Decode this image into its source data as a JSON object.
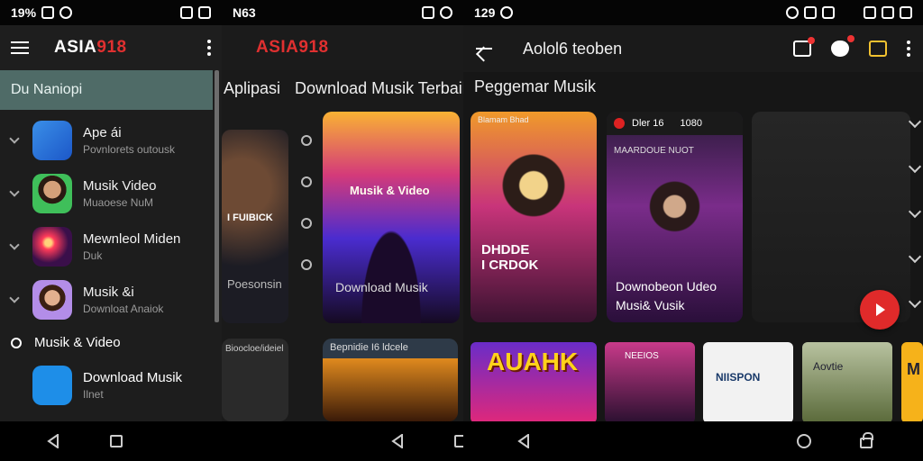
{
  "status": {
    "s1_left": "19%",
    "s2_left": "N63",
    "s3_left": "129"
  },
  "drawer": {
    "logo_white": "ASIA",
    "logo_red": "918",
    "search_text": "Du Naniopi",
    "items": [
      {
        "title": "Ape ái",
        "subtitle": "Povnlorets outousk",
        "icon": "blue-feather-icon"
      },
      {
        "title": "Musik Video",
        "subtitle": "Muaoese NuM",
        "icon": "singer-face-icon"
      },
      {
        "title": "Mewnleol Miden",
        "subtitle": "Duk",
        "icon": "concert-icon"
      },
      {
        "title": "Musik &i",
        "subtitle": "Downloat Anaiok",
        "icon": "girl-portrait-icon"
      }
    ],
    "section_label": "Musik & Video",
    "download_item": {
      "title": "Download Musik",
      "subtitle": "Ilnet"
    }
  },
  "middle": {
    "logo_white": "ASIA",
    "logo_red": "918",
    "tabs": [
      "Aplipasi",
      "Download Musik Terbaik"
    ],
    "card_left": {
      "title": "I FUIBICK",
      "caption": "Poesonsin"
    },
    "card_main": {
      "title": "Musik & Video",
      "caption": "Download Musik"
    },
    "card_bottom_left": {
      "title": "Bioocloe/ideiel"
    },
    "card_bottom_main": {
      "title": "Bepnidie I6 ldcele"
    }
  },
  "detail": {
    "title": "Aolol6 teoben",
    "heading": "Peggemar Musik",
    "card_a": {
      "header": "Blamam Bhad",
      "title": "DHDDE\nI CRDOK"
    },
    "card_b": {
      "header_left": "Dler 16",
      "header_right": "1080",
      "subtitle": "MAARDOUE NUOT",
      "title": "Downobeon Udeo\nMusi& Vusik"
    },
    "thumbs": [
      "AUAHK",
      "NEEIOS",
      "NIISPON",
      "Aovtie",
      "M"
    ]
  }
}
